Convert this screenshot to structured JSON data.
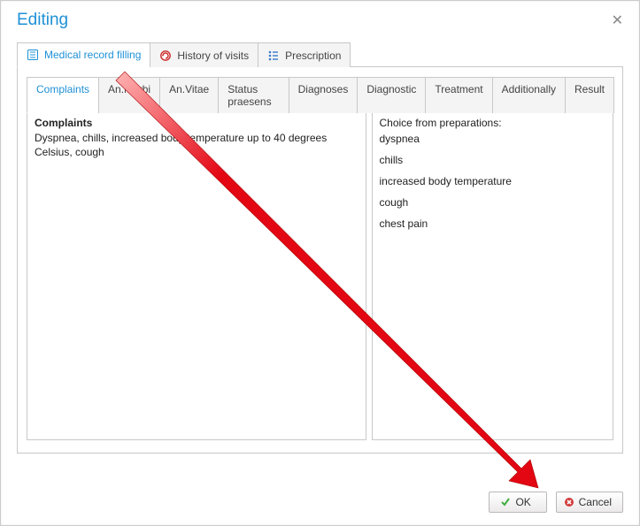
{
  "title": "Editing",
  "outer_tabs": [
    {
      "label": "Medical record filling",
      "icon": "document-list-icon",
      "active": true
    },
    {
      "label": "History of visits",
      "icon": "history-icon",
      "active": false
    },
    {
      "label": "Prescription",
      "icon": "prescription-icon",
      "active": false
    }
  ],
  "inner_tabs": [
    {
      "label": "Complaints",
      "active": true
    },
    {
      "label": "An.Morbi",
      "active": false
    },
    {
      "label": "An.Vitae",
      "active": false
    },
    {
      "label": "Status praesens",
      "active": false
    },
    {
      "label": "Diagnoses",
      "active": false
    },
    {
      "label": "Diagnostic",
      "active": false
    },
    {
      "label": "Treatment",
      "active": false
    },
    {
      "label": "Additionally",
      "active": false
    },
    {
      "label": "Result",
      "active": false
    }
  ],
  "left_panel": {
    "heading": "Complaints",
    "text": "Dyspnea, chills, increased body temperature up to 40 degrees Celsius, cough"
  },
  "right_panel": {
    "heading": "Choice from preparations:",
    "items": [
      "dyspnea",
      "chills",
      "increased body temperature",
      "cough",
      "chest pain"
    ]
  },
  "buttons": {
    "ok": "OK",
    "cancel": "Cancel"
  },
  "annotation": {
    "arrow_color": "#e30613"
  }
}
